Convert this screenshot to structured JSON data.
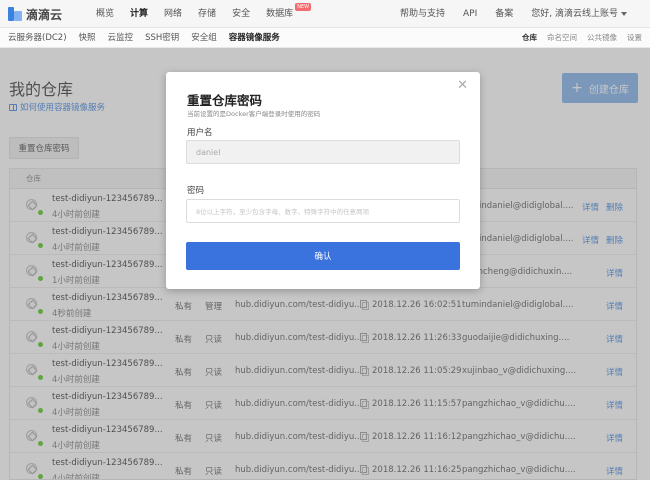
{
  "topbar": {
    "brand": "滴滴云",
    "nav": [
      "概览",
      "计算",
      "网络",
      "存储",
      "安全",
      "数据库"
    ],
    "new_badge": "NEW",
    "right": [
      "帮助与支持",
      "API",
      "备案",
      "您好, 滴滴云线上账号"
    ]
  },
  "subbar": {
    "items": [
      "云服务器(DC2)",
      "快照",
      "云监控",
      "SSH密钥",
      "安全组",
      "容器镜像服务"
    ],
    "right": [
      "仓库",
      "命名空间",
      "公共镜像",
      "设置"
    ]
  },
  "page": {
    "title": "我的仓库",
    "help_link": "如何使用容器镜像服务",
    "create_button": "创建仓库",
    "reset_button": "重置仓库密码"
  },
  "table": {
    "header_repo": "仓库",
    "rows": [
      {
        "name": "test-didiyun-123456789...",
        "time": "4小时前创建",
        "visibility": "",
        "permission": "",
        "address": "",
        "date": "",
        "owner": "tumindaniel@didiglobal....",
        "detail": "详情",
        "delete": "删除"
      },
      {
        "name": "test-didiyun-123456789...",
        "time": "4小时前创建",
        "visibility": "",
        "permission": "",
        "address": "",
        "date": "",
        "owner": "tumindaniel@didiglobal....",
        "detail": "详情",
        "delete": "删除"
      },
      {
        "name": "test-didiyun-123456789...",
        "time": "1小时前创建",
        "visibility": "",
        "permission": "",
        "address": "",
        "date": "",
        "owner": "xuancheng@didichuxin....",
        "detail": "详情",
        "delete": ""
      },
      {
        "name": "test-didiyun-123456789...",
        "time": "4秒前创建",
        "visibility": "私有",
        "permission": "管理",
        "address": "hub.didiyun.com/test-didiyu...",
        "date": "2018.12.26 16:02:51",
        "owner": "tumindaniel@didiglobal....",
        "detail": "详情",
        "delete": ""
      },
      {
        "name": "test-didiyun-123456789...",
        "time": "4小时前创建",
        "visibility": "私有",
        "permission": "只读",
        "address": "hub.didiyun.com/test-didiyu...",
        "date": "2018.12.26 11:26:33",
        "owner": "guodaijie@didichuxing....",
        "detail": "详情",
        "delete": ""
      },
      {
        "name": "test-didiyun-123456789...",
        "time": "4小时前创建",
        "visibility": "私有",
        "permission": "只读",
        "address": "hub.didiyun.com/test-didiyu...",
        "date": "2018.12.26 11:05:29",
        "owner": "xujinbao_v@didichuxing....",
        "detail": "详情",
        "delete": ""
      },
      {
        "name": "test-didiyun-123456789...",
        "time": "4小时前创建",
        "visibility": "私有",
        "permission": "只读",
        "address": "hub.didiyun.com/test-didiyu...",
        "date": "2018.12.26 11:15:57",
        "owner": "pangzhichao_v@didichu....",
        "detail": "详情",
        "delete": ""
      },
      {
        "name": "test-didiyun-123456789...",
        "time": "4小时前创建",
        "visibility": "私有",
        "permission": "只读",
        "address": "hub.didiyun.com/test-didiyu...",
        "date": "2018.12.26 11:16:12",
        "owner": "pangzhichao_v@didichu....",
        "detail": "详情",
        "delete": ""
      },
      {
        "name": "test-didiyun-123456789...",
        "time": "4小时前创建",
        "visibility": "私有",
        "permission": "只读",
        "address": "hub.didiyun.com/test-didiyu...",
        "date": "2018.12.26 11:16:25",
        "owner": "pangzhichao_v@didichu....",
        "detail": "详情",
        "delete": ""
      }
    ]
  },
  "modal": {
    "title": "重置仓库密码",
    "subtitle": "当前设置的是Docker客户端登录时使用的密码",
    "username_label": "用户名",
    "username_value": "daniel",
    "password_label": "密码",
    "password_placeholder": "8位以上字符，至少包含字母、数字、特殊字符中的任意两项",
    "confirm_button": "确认",
    "close_icon": "close-icon"
  }
}
